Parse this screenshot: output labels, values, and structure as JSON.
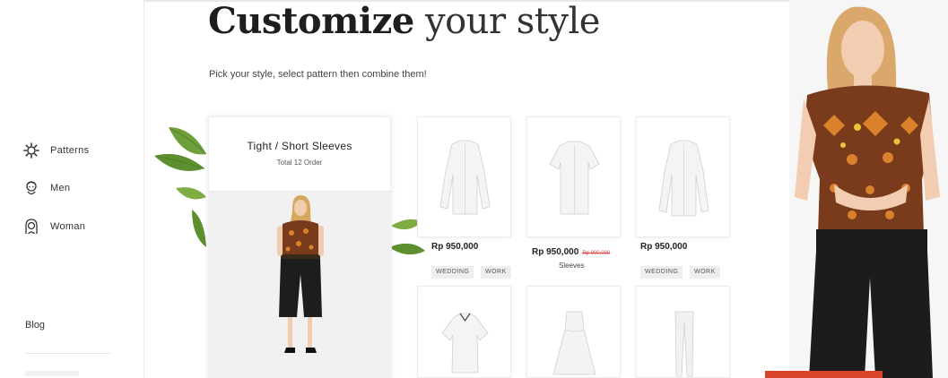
{
  "hero": {
    "title_bold": "Customize",
    "title_rest": "your style",
    "subtitle": "Pick your style, select pattern then combine them!"
  },
  "sidebar": {
    "items": [
      {
        "label": "Patterns",
        "icon": "gear-icon"
      },
      {
        "label": "Men",
        "icon": "man-icon"
      },
      {
        "label": "Woman",
        "icon": "woman-icon"
      }
    ],
    "blog_label": "Blog"
  },
  "featured": {
    "title": "Tight / Short Sleeves",
    "subtitle": "Total 12 Order"
  },
  "products": [
    {
      "icon": "long-sleeve-shirt-icon",
      "price": "Rp 950,000",
      "tags": [
        "WEDDING",
        "WORK"
      ]
    },
    {
      "icon": "short-sleeve-shirt-icon",
      "price": "Rp 950,000",
      "old_price": "Rp 900,000",
      "caption": "Sleeves"
    },
    {
      "icon": "long-sleeve-shirt-icon",
      "price": "Rp 950,000",
      "tags": [
        "WEDDING",
        "WORK"
      ]
    },
    {
      "icon": "blouse-icon"
    },
    {
      "icon": "dress-icon"
    },
    {
      "icon": "trousers-icon"
    }
  ],
  "colors": {
    "accent": "#d8432b",
    "batik_brown": "#7a3a1c",
    "batik_orange": "#d9822b"
  }
}
